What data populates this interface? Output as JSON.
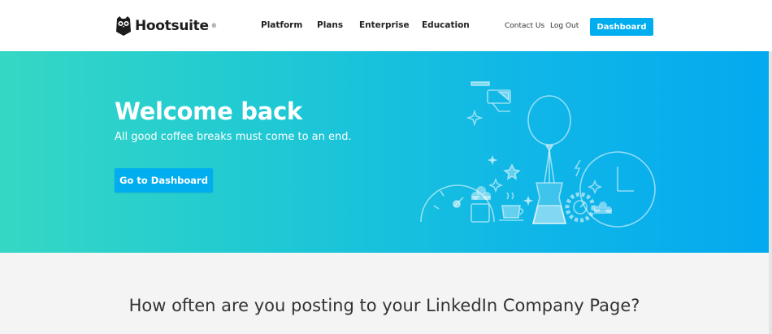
{
  "brand": {
    "name": "Hootsuite",
    "reg": "®",
    "logo_icon": "owl-icon",
    "accent_color": "#00aeef"
  },
  "nav": {
    "main": [
      "Platform",
      "Plans",
      "Enterprise",
      "Education"
    ],
    "contact": "Contact Us",
    "logout": "Log Out",
    "dashboard": "Dashboard"
  },
  "hero": {
    "title": "Welcome back",
    "subtitle": "All good coffee breaks must come to an end.",
    "cta": "Go to Dashboard",
    "gradient_start": "#35d7c4",
    "gradient_end": "#04a9ef"
  },
  "survey": {
    "question": "How often are you posting to your LinkedIn Company Page?"
  }
}
